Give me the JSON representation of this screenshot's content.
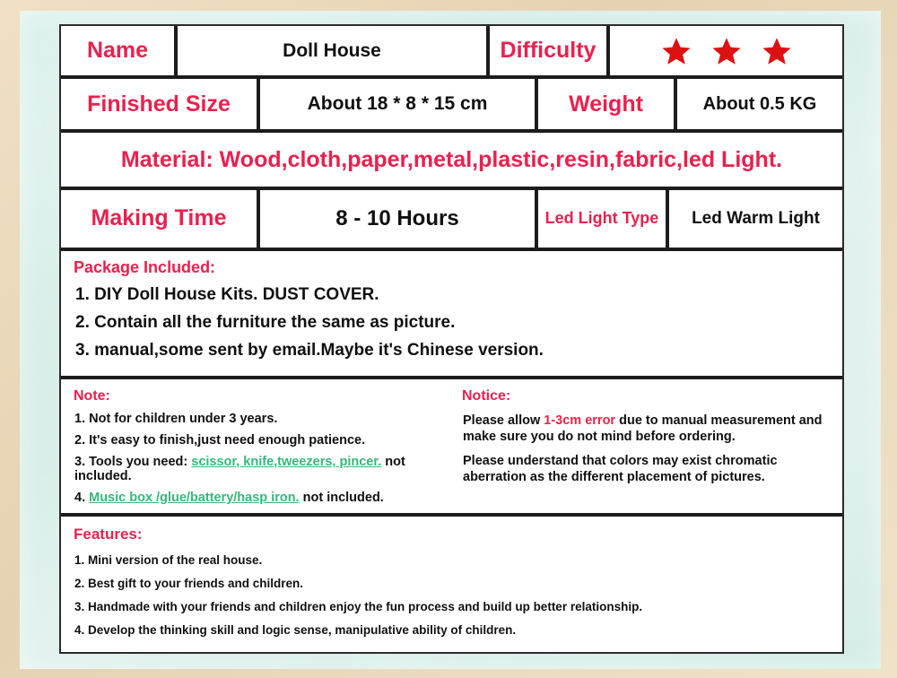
{
  "spec_rows": {
    "name_label": "Name",
    "name_value": "Doll House",
    "difficulty_label": "Difficulty",
    "difficulty_stars": 3,
    "finished_size_label": "Finished Size",
    "finished_size_value": "About  18 * 8 * 15 cm",
    "weight_label": "Weight",
    "weight_value": "About 0.5 KG",
    "material": "Material: Wood,cloth,paper,metal,plastic,resin,fabric,led Light.",
    "making_time_label": "Making Time",
    "making_time_value": "8 - 10 Hours",
    "led_type_label": "Led Light Type",
    "led_type_value": "Led Warm Light"
  },
  "package": {
    "title": "Package Included:",
    "items": [
      "1. DIY Doll House Kits. DUST COVER.",
      "2. Contain all the furniture the same as picture.",
      "3. manual,some sent by email.Maybe it's Chinese version."
    ]
  },
  "note": {
    "title": "Note:",
    "item1": "1. Not for children under 3 years.",
    "item2": "2. It's easy to finish,just need enough patience.",
    "item3_prefix": "3. Tools you need: ",
    "item3_tools": "scissor, knife,tweezers, pincer.",
    "item3_suffix": " not included.",
    "item4_prefix": "4. ",
    "item4_tools": "Music box /glue/battery/hasp iron.",
    "item4_suffix": " not included."
  },
  "notice": {
    "title": "Notice:",
    "line1_prefix": "Please allow ",
    "line1_highlight": "1-3cm error",
    "line1_suffix": " due to manual measurement and make sure you do not mind before ordering.",
    "line2": "Please understand that colors may exist chromatic aberration as the different placement of pictures."
  },
  "features": {
    "title": "Features:",
    "items": [
      "1. Mini version of the real house.",
      "2. Best gift to your friends and children.",
      "3. Handmade with your friends and children enjoy the fun process and build up better relationship.",
      "4. Develop the thinking skill and logic sense, manipulative ability of children."
    ]
  },
  "colors": {
    "heading_red": "#e8214e",
    "star_red": "#dd1111",
    "tool_green": "#35b87c",
    "frame_mint": "#d3ece7",
    "paper_tan": "#e8d5b7"
  }
}
